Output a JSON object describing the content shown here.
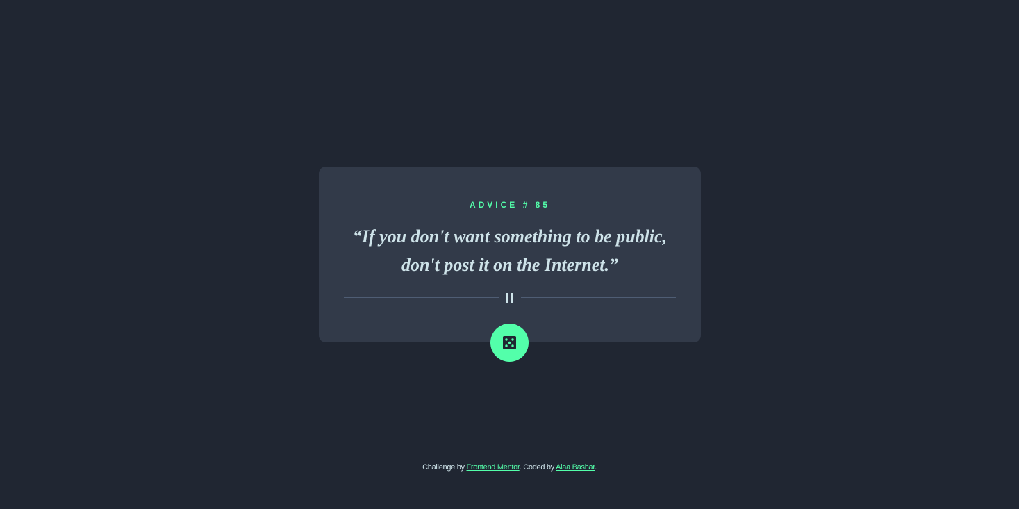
{
  "card": {
    "label": "ADVICE #",
    "advice_number": "85",
    "quote": "“If you don't want something to be public, don't post it on the Internet.”"
  },
  "divider": {
    "icon": "pause-icon"
  },
  "dice_button": {
    "icon": "dice-icon"
  },
  "footer": {
    "prefix": "Challenge by ",
    "link1": "Frontend Mentor",
    "middle": ". Coded by ",
    "link2": "Alaa Bashar",
    "suffix": "."
  },
  "colors": {
    "background": "#202632",
    "card": "#323a49",
    "accent": "#53ffaa",
    "text": "#cee3e9",
    "divider": "#4f5d74"
  }
}
